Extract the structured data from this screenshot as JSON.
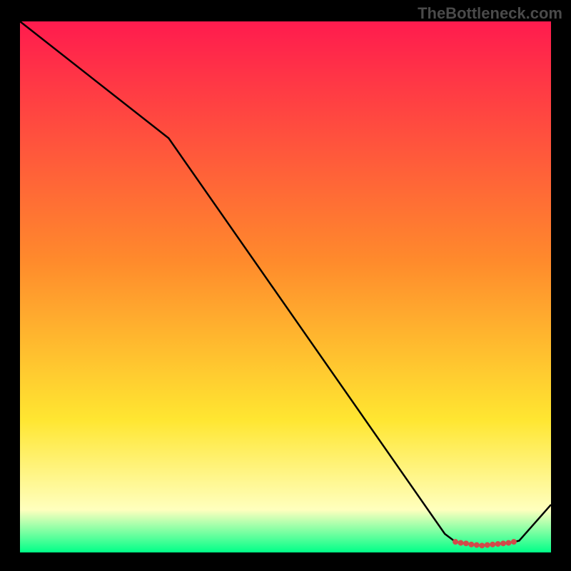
{
  "attribution": "TheBottleneck.com",
  "chart_data": {
    "type": "line",
    "title": "",
    "xlabel": "",
    "ylabel": "",
    "xlim": [
      0,
      100
    ],
    "ylim": [
      0,
      100
    ],
    "x": [
      0,
      28,
      80,
      82,
      84,
      85,
      87,
      89,
      90,
      92,
      94,
      100
    ],
    "values": [
      100,
      78,
      3.5,
      2,
      1.7,
      1.5,
      1.3,
      1.5,
      1.6,
      1.8,
      2.2,
      9
    ],
    "markers_x": [
      82,
      83,
      84,
      85,
      86,
      87,
      88,
      89,
      90,
      91,
      92,
      93
    ],
    "markers_y": [
      2.0,
      1.8,
      1.7,
      1.5,
      1.4,
      1.3,
      1.4,
      1.5,
      1.6,
      1.7,
      1.8,
      2.0
    ],
    "marker_color": "#d24a4a",
    "line_color": "#000000",
    "gradient_top": "#ff1b4e",
    "gradient_mid_top": "#ff8a2c",
    "gradient_mid": "#ffe631",
    "gradient_low": "#ffffbe",
    "gradient_bot": "#00ff88"
  }
}
